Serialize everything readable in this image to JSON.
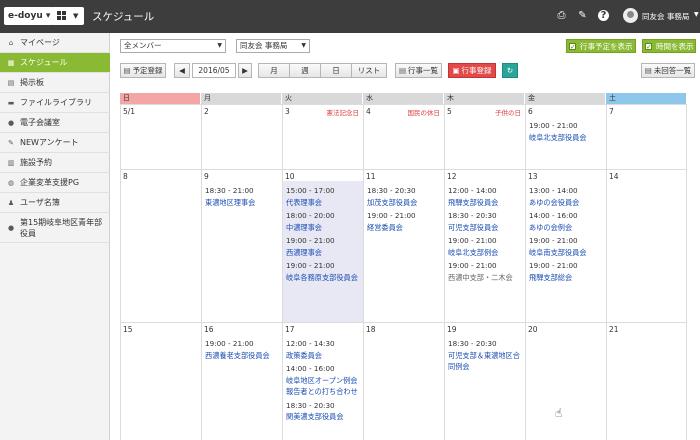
{
  "app": {
    "brand": "e-doyu",
    "title": "スケジュール",
    "user": "同友会 事務局"
  },
  "icons": {
    "print": "print-icon",
    "tools": "wrench-icon",
    "help": "help-icon",
    "user": "user-avatar-icon"
  },
  "sidebar": {
    "items": [
      {
        "label": "マイページ",
        "icon": "home-icon"
      },
      {
        "label": "スケジュール",
        "icon": "calendar-icon"
      },
      {
        "label": "掲示板",
        "icon": "board-icon"
      },
      {
        "label": "ファイルライブラリ",
        "icon": "folder-icon"
      },
      {
        "label": "電子会議室",
        "icon": "conference-icon"
      },
      {
        "label": "NEWアンケート",
        "icon": "survey-icon"
      },
      {
        "label": "施設予約",
        "icon": "facility-icon"
      },
      {
        "label": "企業変革支援PG",
        "icon": "globe-icon"
      },
      {
        "label": "ユーザ名簿",
        "icon": "users-icon"
      },
      {
        "label": "第15期岐阜地区青年部役員",
        "icon": "group-icon"
      }
    ]
  },
  "filters": {
    "member": "全メンバー",
    "dept": "同友会 事務局",
    "show_events": "行事予定を表示",
    "show_time": "時間を表示"
  },
  "toolbar": {
    "add": "予定登録",
    "prev": "◀",
    "month": "2016/05",
    "next": "▶",
    "view_month": "月",
    "view_week": "週",
    "view_day": "日",
    "view_list": "リスト",
    "event_list": "行事一覧",
    "event_reg": "行事登録",
    "unanswered": "未回答一覧"
  },
  "calendar": {
    "headers": [
      "日",
      "月",
      "火",
      "水",
      "木",
      "金",
      "土"
    ],
    "header_colors": [
      "#f4a6a6",
      "#d9d9d9",
      "#d9d9d9",
      "#d9d9d9",
      "#d9d9d9",
      "#d9d9d9",
      "#8ec7ec"
    ],
    "weeks": [
      {
        "days": [
          {
            "num": "5/1",
            "holiday": "",
            "events": []
          },
          {
            "num": "2",
            "holiday": "",
            "events": []
          },
          {
            "num": "3",
            "holiday": "憲法記念日",
            "events": []
          },
          {
            "num": "4",
            "holiday": "国民の休日",
            "events": []
          },
          {
            "num": "5",
            "holiday": "子供の日",
            "events": []
          },
          {
            "num": "6",
            "holiday": "",
            "events": [
              {
                "time": "19:00 - 21:00",
                "name": "岐阜北支部役員会"
              }
            ]
          },
          {
            "num": "7",
            "holiday": "",
            "events": []
          }
        ]
      },
      {
        "days": [
          {
            "num": "8",
            "holiday": "",
            "events": []
          },
          {
            "num": "9",
            "holiday": "",
            "events": [
              {
                "time": "18:30 - 21:00",
                "name": "東濃地区理事会"
              }
            ]
          },
          {
            "num": "10",
            "holiday": "",
            "events": [
              {
                "time": "15:00 - 17:00",
                "name": "代表理事会"
              },
              {
                "time": "18:00 - 20:00",
                "name": "中濃理事会"
              },
              {
                "time": "19:00 - 21:00",
                "name": "西濃理事会"
              },
              {
                "time": "19:00 - 21:00",
                "name": "岐阜各務原支部役員会"
              }
            ]
          },
          {
            "num": "11",
            "holiday": "",
            "events": [
              {
                "time": "18:30 - 20:30",
                "name": "加茂支部役員会"
              },
              {
                "time": "19:00 - 21:00",
                "name": "経営委員会"
              }
            ]
          },
          {
            "num": "12",
            "holiday": "",
            "events": [
              {
                "time": "12:00 - 14:00",
                "name": "飛騨支部役員会"
              },
              {
                "time": "18:30 - 20:30",
                "name": "可児支部役員会"
              },
              {
                "time": "19:00 - 21:00",
                "name": "岐阜北支部例会"
              },
              {
                "time": "19:00 - 21:00",
                "gray": "西濃中支部・二木会"
              }
            ]
          },
          {
            "num": "13",
            "holiday": "",
            "events": [
              {
                "time": "13:00 - 14:00",
                "name": "あゆの会役員会"
              },
              {
                "time": "14:00 - 16:00",
                "name": "あゆの会例会"
              },
              {
                "time": "19:00 - 21:00",
                "name": "岐阜南支部役員会"
              },
              {
                "time": "19:00 - 21:00",
                "name": "飛騨支部総会"
              }
            ]
          },
          {
            "num": "14",
            "holiday": "",
            "events": []
          }
        ]
      },
      {
        "days": [
          {
            "num": "15",
            "holiday": "",
            "events": []
          },
          {
            "num": "16",
            "holiday": "",
            "events": [
              {
                "time": "19:00 - 21:00",
                "name": "西濃養老支部役員会"
              }
            ]
          },
          {
            "num": "17",
            "holiday": "",
            "events": [
              {
                "time": "12:00 - 14:30",
                "name": "政策委員会"
              },
              {
                "time": "14:00 - 16:00",
                "name": "岐阜地区オープン例会報告者との打ち合わせ"
              },
              {
                "time": "18:30 - 20:30",
                "name": "関美濃支部役員会"
              }
            ]
          },
          {
            "num": "18",
            "holiday": "",
            "events": []
          },
          {
            "num": "19",
            "holiday": "",
            "events": [
              {
                "time": "18:30 - 20:30",
                "name": "可児支部＆東濃地区合同例会"
              }
            ]
          },
          {
            "num": "20",
            "holiday": "",
            "events": []
          },
          {
            "num": "21",
            "holiday": "",
            "events": []
          }
        ]
      }
    ]
  }
}
